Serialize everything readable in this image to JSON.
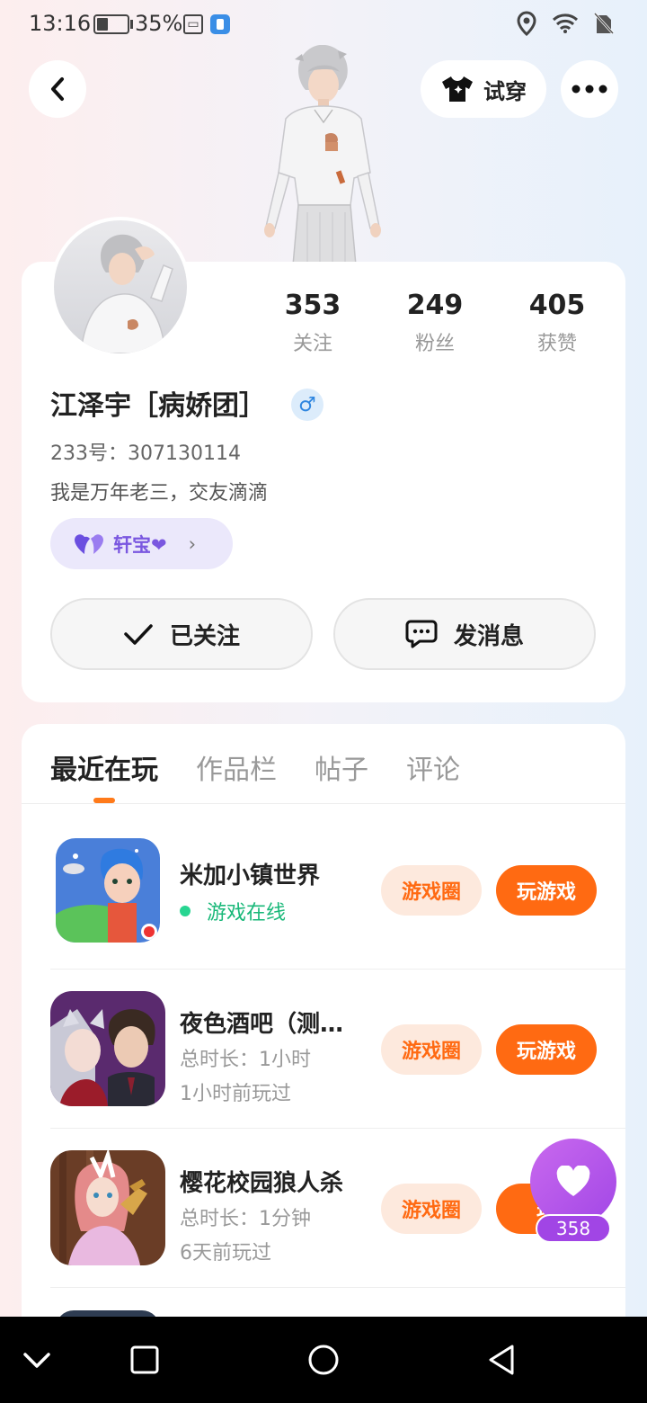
{
  "status_bar": {
    "time": "13:16",
    "battery": "35%",
    "icons": [
      "battery-icon",
      "screenshot-icon",
      "app-notification-icon",
      "location-icon",
      "wifi-icon",
      "no-sim-icon"
    ]
  },
  "header": {
    "try_on_label": "试穿"
  },
  "profile": {
    "stats": [
      {
        "value": "353",
        "label": "关注"
      },
      {
        "value": "249",
        "label": "粉丝"
      },
      {
        "value": "405",
        "label": "获赞"
      }
    ],
    "name": "江泽宇［病娇团］",
    "gender_symbol": "♂",
    "uid": "233号：307130114",
    "bio": "我是万年老三，交友滴滴",
    "cp_name": "轩宝❤",
    "follow_button": "已关注",
    "message_button": "发消息"
  },
  "tabs": [
    "最近在玩",
    "作品栏",
    "帖子",
    "评论"
  ],
  "games": [
    {
      "title": "米加小镇世界",
      "status": "游戏在线",
      "circle": "游戏圈",
      "play": "玩游戏"
    },
    {
      "title": "夜色酒吧（测…",
      "duration": "总时长：1小时",
      "last_played": "1小时前玩过",
      "circle": "游戏圈",
      "play": "玩游戏"
    },
    {
      "title": "樱花校园狼人杀",
      "duration": "总时长：1分钟",
      "last_played": "6天前玩过",
      "circle": "游戏圈",
      "play": "玩"
    }
  ],
  "fab": {
    "count": "358"
  },
  "colors": {
    "accent": "#ff6a12",
    "online": "#19b879",
    "purple": "#a247e6"
  }
}
